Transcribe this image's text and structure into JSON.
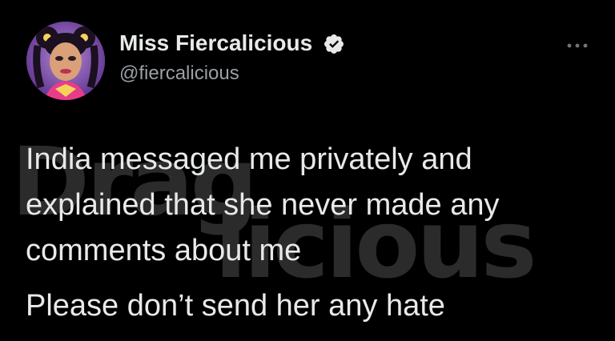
{
  "watermark": {
    "line1": "Drag",
    "line2": "licious"
  },
  "author": {
    "display_name": "Miss Fiercalicious",
    "handle": "@fiercalicious",
    "verified": true,
    "verified_icon": "verified-badge-icon"
  },
  "menu": {
    "icon": "more-options-icon"
  },
  "tweet": {
    "paragraph1": "India messaged me privately and explained that she never made any comments about me",
    "paragraph2": "Please don’t send her any hate"
  },
  "colors": {
    "background": "#000000",
    "text": "#e7e9ea",
    "secondary_text": "#9aa0a6",
    "watermark": "#2b2b2b",
    "verified_badge": "#e7e9ea"
  }
}
